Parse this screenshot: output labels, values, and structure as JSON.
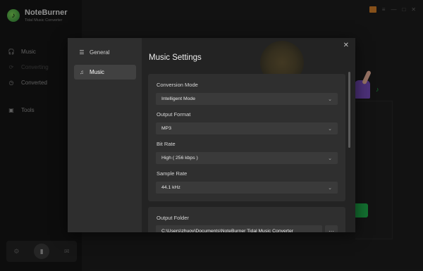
{
  "app": {
    "name": "NoteBurner",
    "subtitle": "Tidal Music Converter",
    "logo_glyph": "♪"
  },
  "sidebar": {
    "items": [
      {
        "label": "Music",
        "icon": "headphones-icon",
        "glyph": "🎧"
      },
      {
        "label": "Converting",
        "icon": "sync-icon",
        "glyph": "⟳"
      },
      {
        "label": "Converted",
        "icon": "clock-icon",
        "glyph": "◷"
      },
      {
        "label": "Tools",
        "icon": "toolbox-icon",
        "glyph": "▣"
      }
    ]
  },
  "bottom_bar": {
    "settings_glyph": "⚙",
    "avatar_glyph": "▮",
    "mail_glyph": "✉"
  },
  "window_controls": {
    "menu": "≡",
    "minimize": "—",
    "maximize": "□",
    "close": "✕"
  },
  "dialog": {
    "nav": [
      {
        "label": "General",
        "icon": "sliders-icon",
        "glyph": "☰"
      },
      {
        "label": "Music",
        "icon": "music-note-icon",
        "glyph": "♫"
      }
    ],
    "selected_nav": "Music",
    "title": "Music Settings",
    "close_glyph": "✕",
    "settings": [
      {
        "label": "Conversion Mode",
        "value": "Intelligent Mode"
      },
      {
        "label": "Output Format",
        "value": "MP3"
      },
      {
        "label": "Bit Rate",
        "value": "High ( 256 kbps )"
      },
      {
        "label": "Sample Rate",
        "value": "44.1 kHz"
      }
    ],
    "output_folder": {
      "label": "Output Folder",
      "value": "C:\\Users\\zhuoy\\Documents\\NoteBurner Tidal Music Converter",
      "browse_glyph": "···"
    }
  },
  "colors": {
    "accent_green": "#1fb54e",
    "cart_orange": "#d9822b",
    "dialog_bg": "#232323"
  }
}
